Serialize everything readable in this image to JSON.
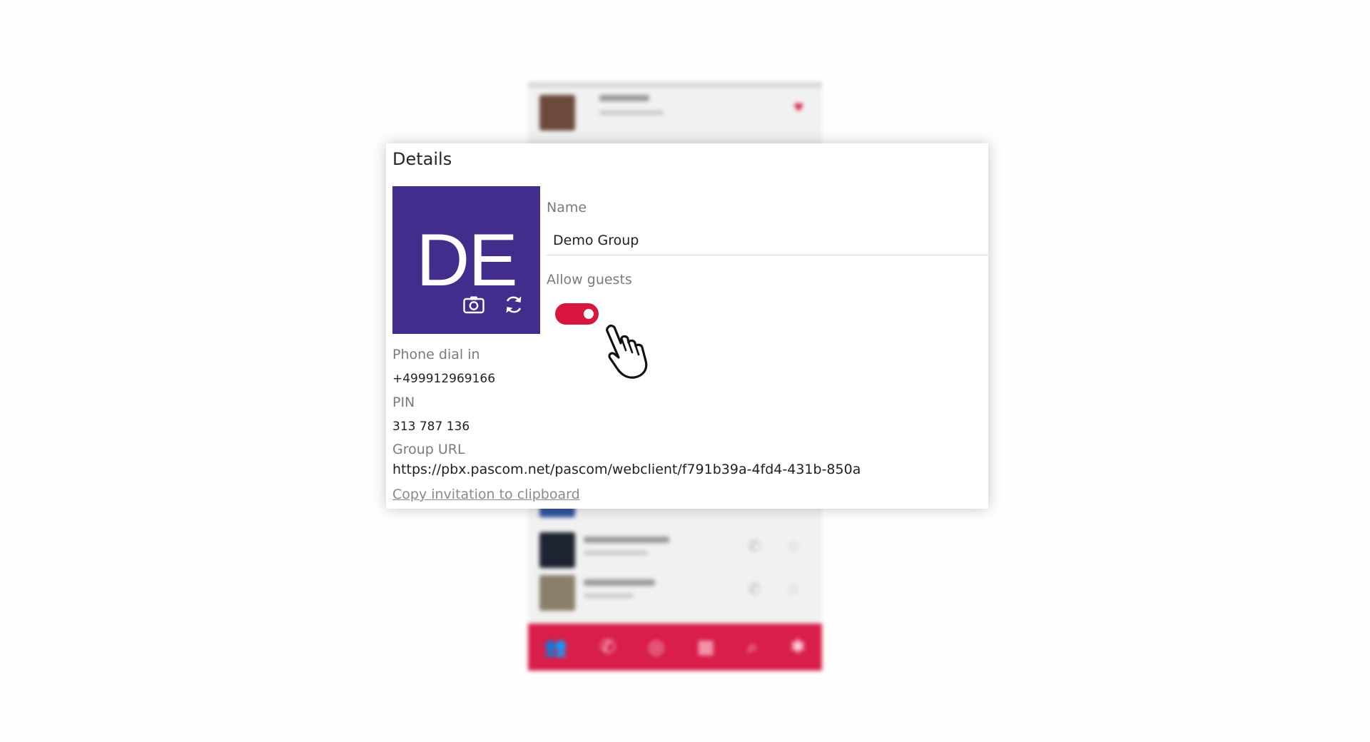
{
  "details": {
    "title": "Details",
    "avatar_initials": "DE",
    "avatar_color": "#432d8c",
    "avatar_actions": [
      {
        "icon": "camera-icon"
      },
      {
        "icon": "refresh-icon"
      }
    ],
    "name_label": "Name",
    "name_value": "Demo Group",
    "allow_guests_label": "Allow guests",
    "allow_guests_enabled": true,
    "toggle_color": "#d9163f",
    "phone_label": "Phone dial in",
    "phone_value": "+499912969166",
    "pin_label": "PIN",
    "pin_value": "313 787 136",
    "url_label": "Group URL",
    "url_value": "https://pbx.pascom.net/pascom/webclient/f791b39a-4fd4-431b-850a",
    "copy_link": "Copy invitation to clipboard"
  },
  "background_app": {
    "nav_color": "#d81e49",
    "nav_icons": [
      "contacts-icon",
      "phone-icon",
      "chat-icon",
      "address-book-icon",
      "search-icon",
      "settings-icon"
    ]
  }
}
